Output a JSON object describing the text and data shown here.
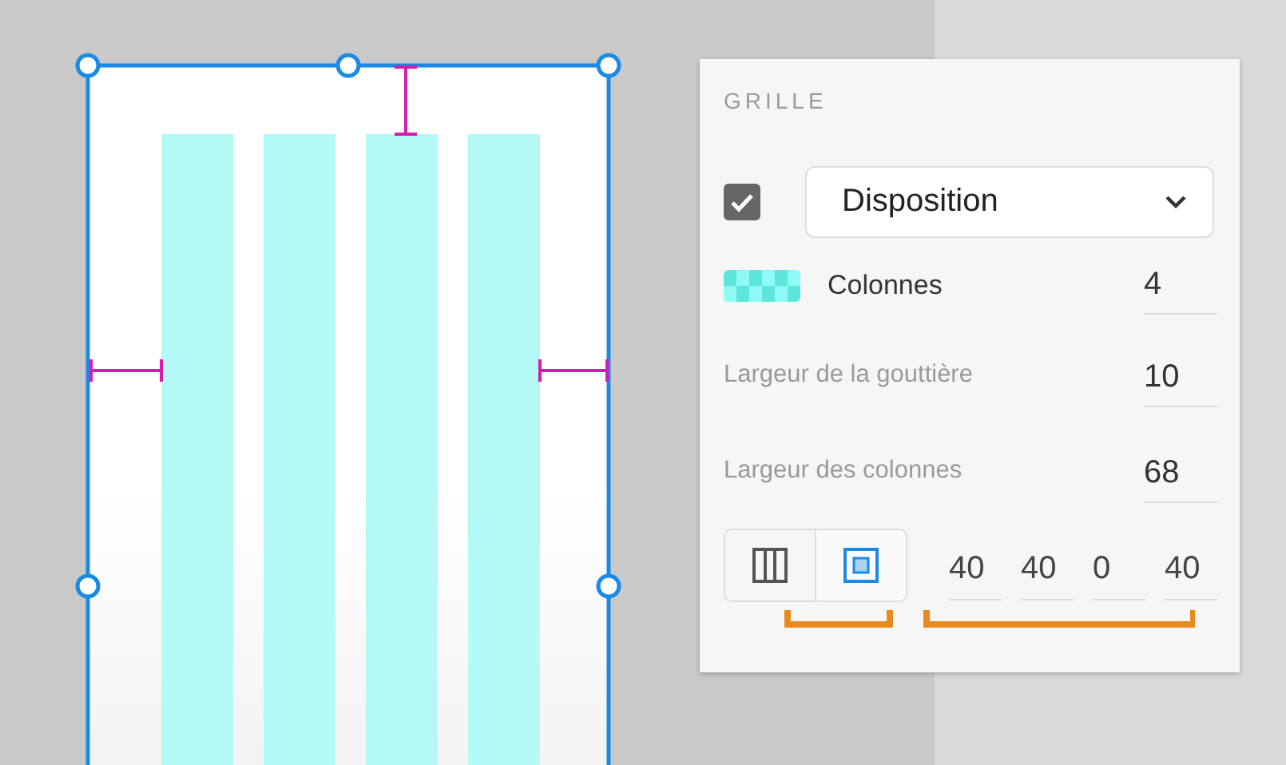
{
  "panel": {
    "title": "GRILLE",
    "enabled": true,
    "layout": "Disposition",
    "columns": {
      "label": "Colonnes",
      "value": "4"
    },
    "gutter": {
      "label": "Largeur de la gouttière",
      "value": "10"
    },
    "column_width": {
      "label": "Largeur des colonnes",
      "value": "68"
    },
    "modes": [
      {
        "kind": "columns",
        "selected": false
      },
      {
        "kind": "margins",
        "selected": true
      }
    ],
    "margins": [
      "40",
      "40",
      "0",
      "40"
    ]
  }
}
